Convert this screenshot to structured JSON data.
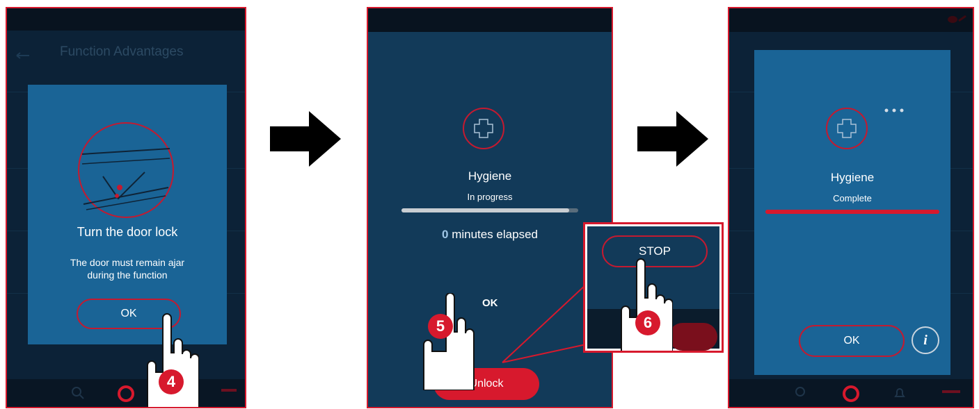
{
  "colors": {
    "accent": "#d7192d",
    "modal": "#1a6496",
    "screen": "#0c2237",
    "text": "#ffffff"
  },
  "screen1": {
    "header_title": "Function Advantages",
    "dialog_title": "Turn the door lock",
    "dialog_message_line1": "The door must remain ajar",
    "dialog_message_line2": "during the function",
    "ok_label": "OK",
    "step_badge": "4"
  },
  "screen2": {
    "function_name": "Hygiene",
    "status": "In progress",
    "progress": 0.95,
    "elapsed_value": "0",
    "elapsed_label": "minutes elapsed",
    "ok_caption": "OK",
    "unlock_label": "Unlock",
    "step_badge": "5",
    "zoom_stop_label": "STOP",
    "zoom_step_badge": "6"
  },
  "screen3": {
    "function_name": "Hygiene",
    "status": "Complete",
    "progress": 1.0,
    "ok_label": "OK",
    "info_label": "i"
  },
  "icons": [
    "plus-cross-icon",
    "door-lock-icon",
    "back-arrow-icon",
    "hand-pointer-icon",
    "more-dots-icon",
    "info-icon",
    "right-arrow-icon"
  ]
}
